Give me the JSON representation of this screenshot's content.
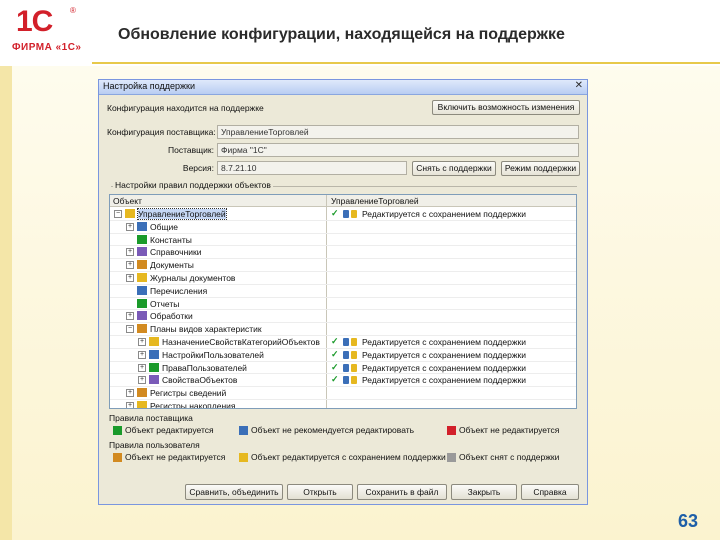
{
  "slide": {
    "logo_mark": "1С",
    "logo_reg": "®",
    "logo_text": "ФИРМА «1С»",
    "title": "Обновление конфигурации, находящейся на поддержке",
    "page_number": "63"
  },
  "window": {
    "title": "Настройка поддержки",
    "close": "✕",
    "under_support_label": "Конфигурация находится на поддержке",
    "enable_changes_button": "Включить возможность изменения",
    "vendor_config_label": "Конфигурация поставщика:",
    "vendor_config_value": "УправлениеТорговлей",
    "vendor_label": "Поставщик:",
    "vendor_value": "Фирма \"1С\"",
    "version_label": "Версия:",
    "version_value": "8.7.21.10",
    "remove_support_button": "Снять с поддержки",
    "support_mode_button": "Режим поддержки",
    "group_title": "Настройки правил поддержки объектов",
    "grid": {
      "col_object": "Объект",
      "col_vendor": "УправлениеТорговлей",
      "rows": [
        {
          "name": "УправлениеТорговлей",
          "exp": "−",
          "indent": 0,
          "selected": true,
          "status": "Редактируется с сохранением поддержки",
          "flags": true
        },
        {
          "name": "Общие",
          "exp": "+",
          "indent": 1,
          "status": "",
          "flags": false
        },
        {
          "name": "Константы",
          "exp": "",
          "indent": 1,
          "status": "",
          "flags": false
        },
        {
          "name": "Справочники",
          "exp": "+",
          "indent": 1,
          "status": "",
          "flags": false
        },
        {
          "name": "Документы",
          "exp": "+",
          "indent": 1,
          "status": "",
          "flags": false
        },
        {
          "name": "Журналы документов",
          "exp": "+",
          "indent": 1,
          "status": "",
          "flags": false
        },
        {
          "name": "Перечисления",
          "exp": "",
          "indent": 1,
          "status": "",
          "flags": false
        },
        {
          "name": "Отчеты",
          "exp": "",
          "indent": 1,
          "status": "",
          "flags": false
        },
        {
          "name": "Обработки",
          "exp": "+",
          "indent": 1,
          "status": "",
          "flags": false
        },
        {
          "name": "Планы видов характеристик",
          "exp": "−",
          "indent": 1,
          "status": "",
          "flags": false
        },
        {
          "name": "НазначениеСвойствКатегорийОбъектов",
          "exp": "+",
          "indent": 2,
          "status": "Редактируется с сохранением поддержки",
          "flags": true
        },
        {
          "name": "НастройкиПользователей",
          "exp": "+",
          "indent": 2,
          "status": "Редактируется с сохранением поддержки",
          "flags": true
        },
        {
          "name": "ПраваПользователей",
          "exp": "+",
          "indent": 2,
          "status": "Редактируется с сохранением поддержки",
          "flags": true
        },
        {
          "name": "СвойстваОбъектов",
          "exp": "+",
          "indent": 2,
          "status": "Редактируется с сохранением поддержки",
          "flags": true
        },
        {
          "name": "Регистры сведений",
          "exp": "+",
          "indent": 1,
          "status": "",
          "flags": false
        },
        {
          "name": "Регистры накопления",
          "exp": "+",
          "indent": 1,
          "status": "",
          "flags": false
        },
        {
          "name": "",
          "exp": "",
          "indent": 0,
          "status": "",
          "flags": false
        }
      ]
    },
    "vendor_rules_title": "Правила поставщика",
    "vendor_rules": [
      {
        "label": "Объект редактируется",
        "color": "#1a9a2a"
      },
      {
        "label": "Объект не рекомендуется редактировать",
        "color": "#3b6fb8"
      },
      {
        "label": "Объект не редактируется",
        "color": "#d2202a"
      }
    ],
    "user_rules_title": "Правила пользователя",
    "user_rules": [
      {
        "label": "Объект не редактируется",
        "color": "#d28a20"
      },
      {
        "label": "Объект редактируется с сохранением поддержки",
        "color": "#e6b820"
      },
      {
        "label": "Объект снят с поддержки",
        "color": "#9a9a9a"
      }
    ],
    "buttons": {
      "compare": "Сравнить, объединить",
      "open": "Открыть",
      "save_to_file": "Сохранить в файл",
      "close": "Закрыть",
      "help": "Справка"
    }
  }
}
